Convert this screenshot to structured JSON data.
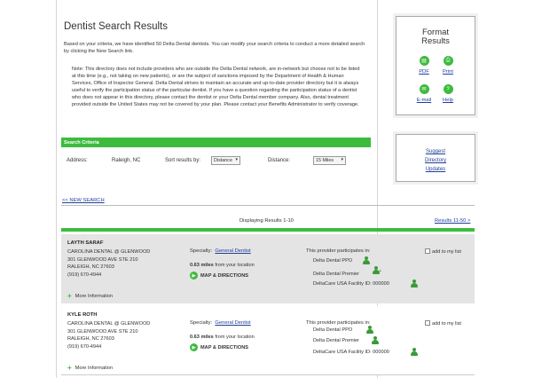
{
  "header": {
    "title": "Dentist Search Results"
  },
  "intro": "Based on your criteria, we have identified 50 Delta Dental dentists. You can modify your search criteria to conduct a more detailed search by clicking the New Search link.",
  "note": "Note: This directory does not include providers who are outside the Delta Dental network, are in-network but choose not to be listed at this time (e.g., not taking on new patients), or are the subject of sanctions imposed by the Department of Health & Human Services, Office of Inspector General. Delta Dental strives to maintain an accurate and up-to-date provider directory but it is always useful to verify the participation status of the particular dentist. If you have a question regarding the participation status of a dentist who does not appear in this directory, please contact the dentist or your Delta Dental member company. Also, dental treatment provided outside the United States may not be covered by your plan. Please contact your Benefits Administrator to verify coverage.",
  "criteria": {
    "bar_label": "Search Criteria",
    "address_label": "Address:",
    "address_value": "Raleigh, NC",
    "sort_label": "Sort results by:",
    "sort_value": "Distance",
    "distance_label": "Distance:",
    "distance_value": "15 Miles"
  },
  "nav": {
    "new_search": "<< NEW SEARCH",
    "displaying": "Displaying Results 1-10",
    "next_results": "Results 11-50 >"
  },
  "format": {
    "title_line1": "Format",
    "title_line2": "Results",
    "pdf": "PDF",
    "print": "Print",
    "email": "E-mail",
    "help": "Help"
  },
  "suggest": {
    "line1": "Suggest",
    "line2": "Directory",
    "line3": "Updates"
  },
  "results": [
    {
      "name": "LAYTH SARAF",
      "practice": "CAROLINA DENTAL @ GLENWOOD",
      "street": "301 GLENWOOD AVE STE 210",
      "city": "RALEIGH, NC 27603",
      "phone": "(919) 670-4944",
      "specialty_label": "Specialty:",
      "specialty": "General Dentist",
      "miles": "0.63 miles",
      "miles_suffix": "from your location",
      "map": "MAP & DIRECTIONS",
      "participates": "This provider participates in:",
      "networks": [
        "Delta Dental PPO",
        "Delta Dental Premier",
        "DeltaCare USA  Facility ID: 000000"
      ],
      "add_to_list": "add to my list",
      "more": "More Information"
    },
    {
      "name": "KYLE ROTH",
      "practice": "CAROLINA DENTAL @ GLENWOOD",
      "street": "301 GLENWOOD AVE STE 210",
      "city": "RALEIGH, NC 27603",
      "phone": "(919) 670-4944",
      "specialty_label": "Specialty:",
      "specialty": "General Dentist",
      "miles": "0.63 miles",
      "miles_suffix": "from your location",
      "map": "MAP & DIRECTIONS",
      "participates": "This provider participates in:",
      "networks": [
        "Delta Dental PPO",
        "Delta Dental Premier",
        "DeltaCare USA  Facility ID: 000000"
      ],
      "add_to_list": "add to my list",
      "more": "More Information"
    }
  ],
  "colors": {
    "accent": "#3dbb3d",
    "link": "#1f3f9a",
    "row_alt": "#e4e4e4"
  }
}
